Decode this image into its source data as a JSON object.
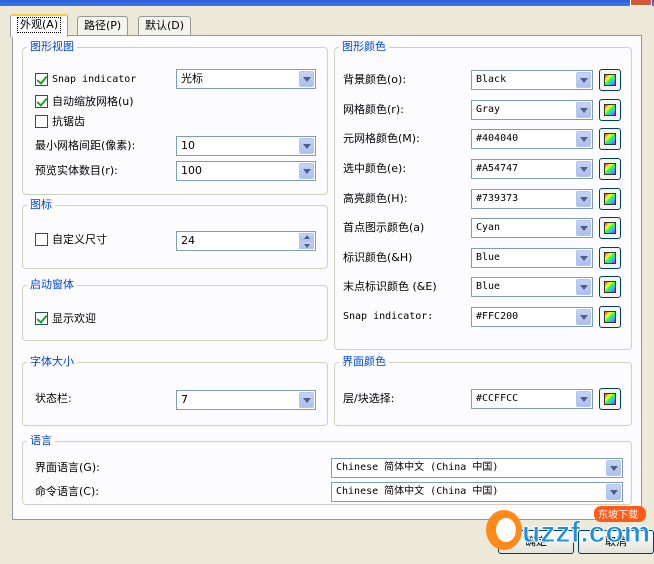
{
  "tabs": [
    {
      "label": "外观(A)"
    },
    {
      "label": "路径(P)"
    },
    {
      "label": "默认(D)"
    }
  ],
  "graphics_view": {
    "title": "图形视图",
    "snap_indicator": {
      "label": "Snap indicator",
      "checked": true,
      "value": "光标"
    },
    "auto_scale_grid": {
      "label": "自动缩放网格(u)",
      "checked": true
    },
    "antialias": {
      "label": "抗锯齿",
      "checked": false
    },
    "min_grid_spacing": {
      "label": "最小网格间距(像素):",
      "value": "10"
    },
    "preview_entities": {
      "label": "预览实体数目(r):",
      "value": "100"
    }
  },
  "icons": {
    "title": "图标",
    "custom_size": {
      "label": "自定义尺寸",
      "checked": false,
      "value": "24"
    }
  },
  "startup": {
    "title": "启动窗体",
    "show_welcome": {
      "label": "显示欢迎",
      "checked": true
    }
  },
  "font_size": {
    "title": "字体大小",
    "status_bar": {
      "label": "状态栏:",
      "value": "7"
    }
  },
  "graphics_colors": {
    "title": "图形颜色",
    "rows": [
      {
        "label": "背景颜色(o):",
        "value": "Black"
      },
      {
        "label": "网格颜色(r):",
        "value": "Gray"
      },
      {
        "label": "元网格颜色(M):",
        "value": "#404040"
      },
      {
        "label": "选中颜色(e):",
        "value": "#A54747"
      },
      {
        "label": "高亮颜色(H):",
        "value": "#739373"
      },
      {
        "label": "首点图示颜色(a)",
        "value": "Cyan"
      },
      {
        "label": "标识颜色(&H)",
        "value": "Blue"
      },
      {
        "label": "末点标识颜色 (&E)",
        "value": "Blue"
      },
      {
        "label": "Snap indicator:",
        "value": "#FFC200"
      }
    ]
  },
  "ui_colors": {
    "title": "界面颜色",
    "layer_block": {
      "label": "层/块选择:",
      "value": "#CCFFCC"
    }
  },
  "language": {
    "title": "语言",
    "ui_language": {
      "label": "界面语言(G):",
      "value": "Chinese 简体中文 (China 中国)"
    },
    "cmd_language": {
      "label": "命令语言(C):",
      "value": "Chinese 简体中文 (China 中国)"
    }
  },
  "buttons": {
    "ok": "确定",
    "cancel": "取消"
  },
  "watermark": {
    "brand": "uzzf.com",
    "badge": "东坡下载"
  },
  "colors": {
    "group_title": "#0046d5",
    "panel_bg": "#fcfcfe",
    "dialog_bg": "#ece9d8",
    "combo_border": "#7f9db9"
  }
}
